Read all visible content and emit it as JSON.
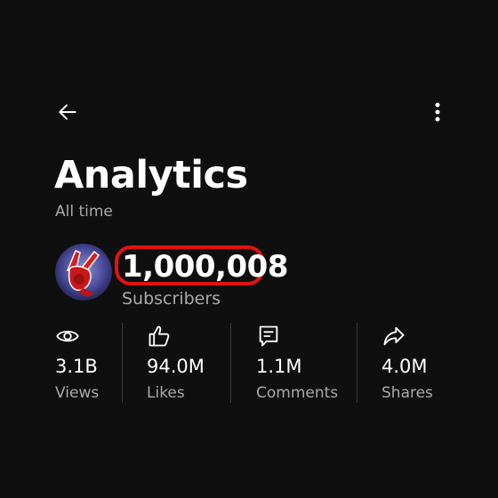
{
  "header": {
    "back_icon": "arrow-left-icon",
    "more_icon": "more-vertical-icon"
  },
  "page": {
    "title": "Analytics",
    "period": "All time"
  },
  "channel": {
    "avatar": "peace-sign-hand-avatar",
    "subscriber_count": "1,000,008",
    "subscriber_label": "Subscribers",
    "highlight_color": "#e31212"
  },
  "stats": [
    {
      "icon": "eye-icon",
      "value": "3.1B",
      "label": "Views"
    },
    {
      "icon": "thumbs-up-icon",
      "value": "94.0M",
      "label": "Likes"
    },
    {
      "icon": "comment-icon",
      "value": "1.1M",
      "label": "Comments"
    },
    {
      "icon": "share-icon",
      "value": "4.0M",
      "label": "Shares"
    }
  ],
  "colors": {
    "background": "#0f0f0f",
    "text": "#ffffff",
    "secondary_text": "#aaaaaa"
  }
}
